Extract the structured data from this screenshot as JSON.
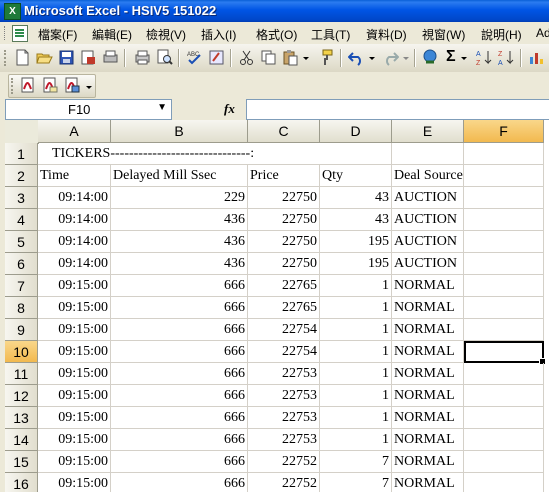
{
  "window": {
    "title": "Microsoft Excel - HSIV5 151022"
  },
  "menu": [
    {
      "label": "檔案(F)"
    },
    {
      "label": "編輯(E)"
    },
    {
      "label": "檢視(V)"
    },
    {
      "label": "插入(I)"
    },
    {
      "label": "格式(O)"
    },
    {
      "label": "工具(T)"
    },
    {
      "label": "資料(D)"
    },
    {
      "label": "視窗(W)"
    },
    {
      "label": "說明(H)"
    },
    {
      "label": "Ad"
    }
  ],
  "toolbar": {
    "icons": [
      "new-icon",
      "open-icon",
      "save-icon",
      "permission-icon",
      "print-preview-icon",
      "print-icon",
      "preview-icon",
      "spelling-icon",
      "research-icon",
      "cut-icon",
      "copy-icon",
      "paste-icon",
      "format-painter-icon",
      "undo-icon",
      "redo-icon",
      "hyperlink-icon",
      "autosum-icon",
      "sort-ascending-icon",
      "sort-descending-icon",
      "chart-icon"
    ],
    "autosum_symbol": "Σ"
  },
  "toolbar2": {
    "icons": [
      "pdf-create-icon",
      "pdf-email-icon",
      "pdf-review-icon"
    ]
  },
  "formula_bar": {
    "name_box": "F10",
    "fx_label": "fx",
    "value": ""
  },
  "grid": {
    "columns": [
      "A",
      "B",
      "C",
      "D",
      "E",
      "F"
    ],
    "active_column": "F",
    "active_row": "10",
    "selected_cell": "F10",
    "rows": [
      {
        "n": "1",
        "cells": [
          "TICKERS------------------------------:",
          "",
          "",
          "",
          "",
          ""
        ]
      },
      {
        "n": "2",
        "cells": [
          "Time",
          "Delayed Mill Ssec",
          "Price",
          "Qty",
          "Deal Source",
          ""
        ]
      },
      {
        "n": "3",
        "cells": [
          "09:14:00",
          "229",
          "22750",
          "43",
          "AUCTION",
          ""
        ]
      },
      {
        "n": "4",
        "cells": [
          "09:14:00",
          "436",
          "22750",
          "43",
          "AUCTION",
          ""
        ]
      },
      {
        "n": "5",
        "cells": [
          "09:14:00",
          "436",
          "22750",
          "195",
          "AUCTION",
          ""
        ]
      },
      {
        "n": "6",
        "cells": [
          "09:14:00",
          "436",
          "22750",
          "195",
          "AUCTION",
          ""
        ]
      },
      {
        "n": "7",
        "cells": [
          "09:15:00",
          "666",
          "22765",
          "1",
          "NORMAL",
          ""
        ]
      },
      {
        "n": "8",
        "cells": [
          "09:15:00",
          "666",
          "22765",
          "1",
          "NORMAL",
          ""
        ]
      },
      {
        "n": "9",
        "cells": [
          "09:15:00",
          "666",
          "22754",
          "1",
          "NORMAL",
          ""
        ]
      },
      {
        "n": "10",
        "cells": [
          "09:15:00",
          "666",
          "22754",
          "1",
          "NORMAL",
          ""
        ]
      },
      {
        "n": "11",
        "cells": [
          "09:15:00",
          "666",
          "22753",
          "1",
          "NORMAL",
          ""
        ]
      },
      {
        "n": "12",
        "cells": [
          "09:15:00",
          "666",
          "22753",
          "1",
          "NORMAL",
          ""
        ]
      },
      {
        "n": "13",
        "cells": [
          "09:15:00",
          "666",
          "22753",
          "1",
          "NORMAL",
          ""
        ]
      },
      {
        "n": "14",
        "cells": [
          "09:15:00",
          "666",
          "22753",
          "1",
          "NORMAL",
          ""
        ]
      },
      {
        "n": "15",
        "cells": [
          "09:15:00",
          "666",
          "22752",
          "7",
          "NORMAL",
          ""
        ]
      },
      {
        "n": "16",
        "cells": [
          "09:15:00",
          "666",
          "22752",
          "7",
          "NORMAL",
          ""
        ]
      }
    ]
  }
}
